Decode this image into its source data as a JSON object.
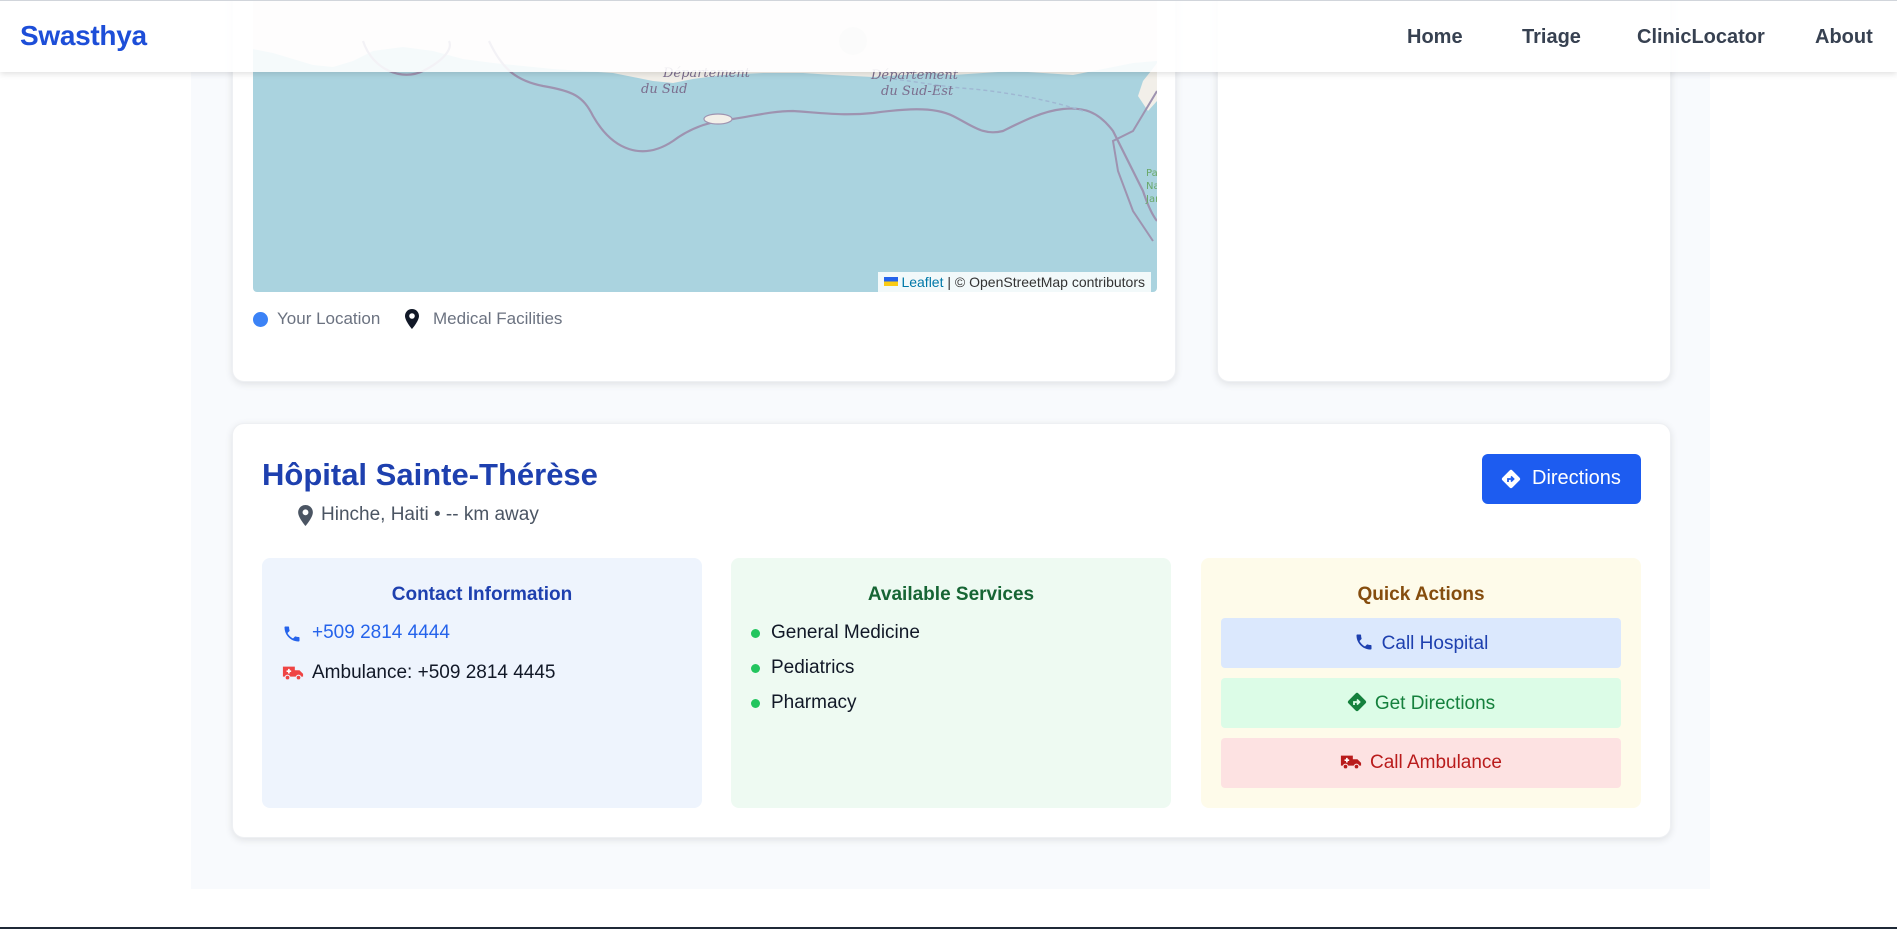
{
  "navbar": {
    "brand": "Swasthya",
    "links": [
      "Home",
      "Triage",
      "ClinicLocator",
      "About"
    ]
  },
  "map": {
    "labels": {
      "sud": [
        "Département",
        "du Sud"
      ],
      "sud_est": [
        "Département",
        "du Sud-Est"
      ]
    },
    "attribution": {
      "link": "Leaflet",
      "text": "| © OpenStreetMap contributors"
    },
    "legend": {
      "your_location": "Your Location",
      "medical_facilities": "Medical Facilities"
    }
  },
  "hospital": {
    "name": "Hôpital Sainte-Thérèse",
    "location": "Hinche, Haiti • -- km away",
    "directions_button": "Directions",
    "contact": {
      "title": "Contact Information",
      "phone": "+509 2814 4444",
      "ambulance": "Ambulance: +509 2814 4445"
    },
    "services": {
      "title": "Available Services",
      "items": [
        "General Medicine",
        "Pediatrics",
        "Pharmacy"
      ]
    },
    "actions": {
      "title": "Quick Actions",
      "call_hospital": "Call Hospital",
      "get_directions": "Get Directions",
      "call_ambulance": "Call Ambulance"
    }
  },
  "colors": {
    "brand": "#1d4ed8",
    "primary_button": "#1d5cf0",
    "water": "#aad3df",
    "service_dot": "#22c55e"
  },
  "icons": [
    "map-pin-icon",
    "directions-icon",
    "phone-icon",
    "ambulance-icon"
  ]
}
